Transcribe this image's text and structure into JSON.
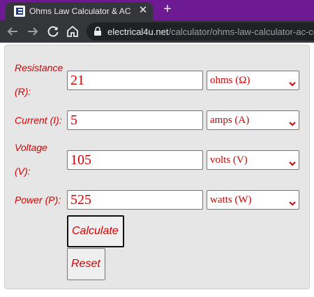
{
  "browser": {
    "tab_title": "Ohms Law Calculator & AC Comp",
    "close_glyph": "✕",
    "new_tab_glyph": "+",
    "url_host": "electrical4u.net",
    "url_path": "/calculator/ohms-law-calculator-ac-cor"
  },
  "calculator": {
    "resistance": {
      "label": "Resistance",
      "label2": "(R):",
      "value": "21",
      "unit": "ohms (Ω)"
    },
    "current": {
      "label": "Current (I):",
      "value": "5",
      "unit": "amps (A)"
    },
    "voltage": {
      "label": "Voltage",
      "label2": "(V):",
      "value": "105",
      "unit": "volts (V)"
    },
    "power": {
      "label": "Power (P):",
      "value": "525",
      "unit": "watts (W)"
    },
    "calculate_label": "Calculate",
    "reset_label": "Reset"
  },
  "colors": {
    "accent": "#d40000",
    "tabstrip": "#6e1a92",
    "toolbar": "#35363a"
  }
}
